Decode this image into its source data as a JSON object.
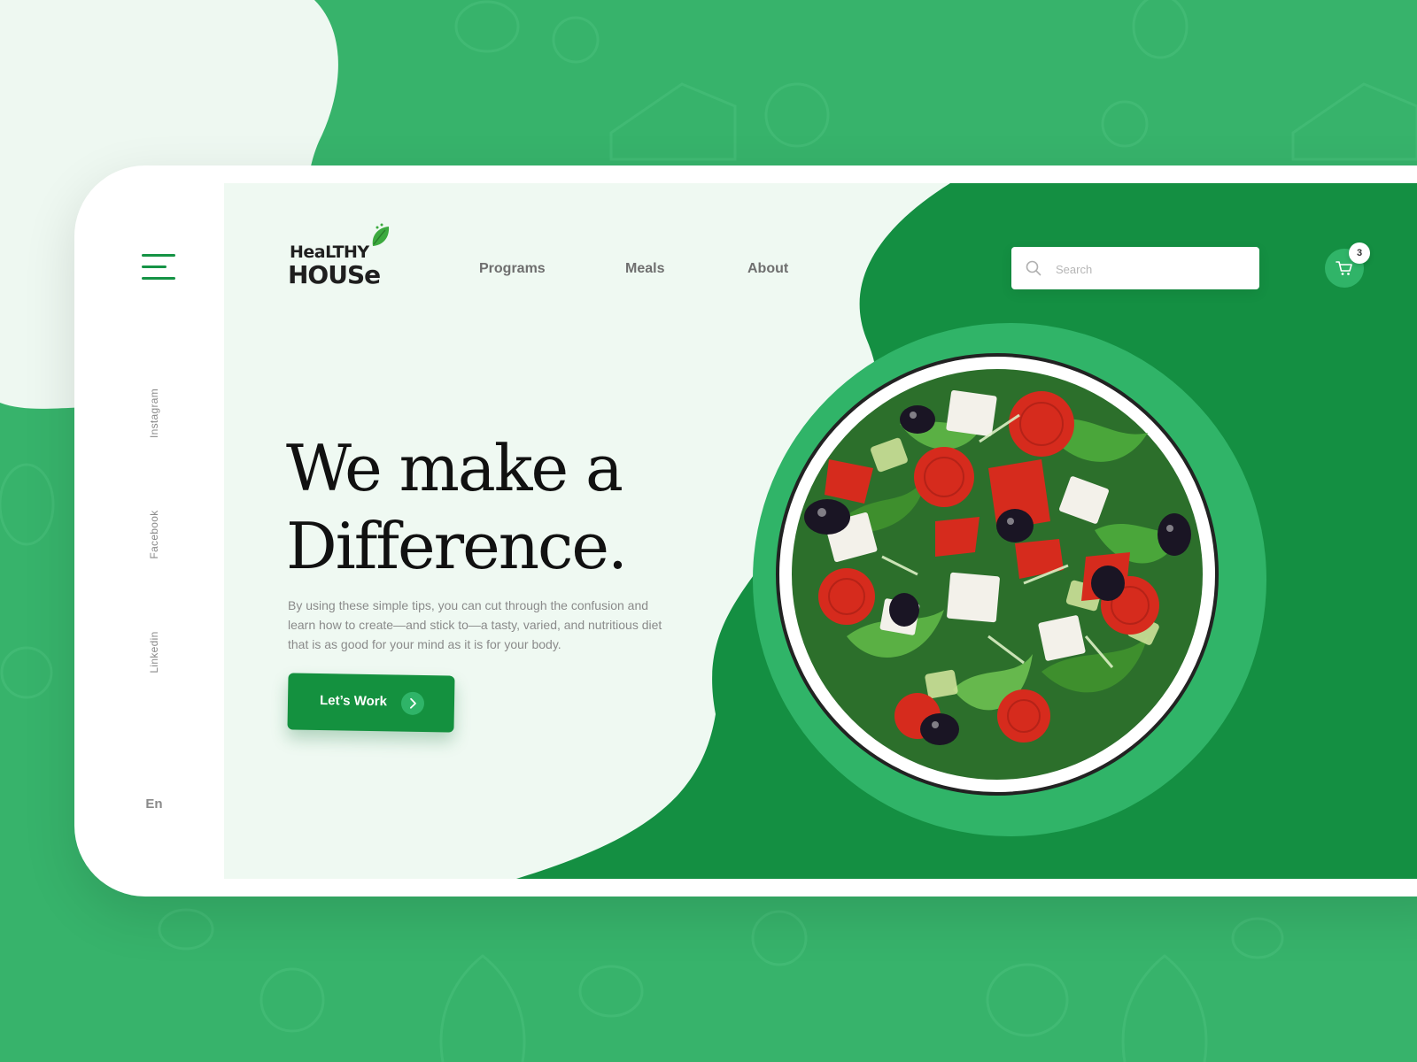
{
  "brand": {
    "line1": "HeaLTHY",
    "line2": "HOUSe"
  },
  "nav": [
    {
      "label": "Programs"
    },
    {
      "label": "Meals"
    },
    {
      "label": "About"
    }
  ],
  "search": {
    "placeholder": "Search"
  },
  "cart": {
    "count": "3"
  },
  "social": [
    "Instagram",
    "Facebook",
    "Linkedin"
  ],
  "language": "En",
  "hero": {
    "title_line1": "We make a",
    "title_line2": "Difference.",
    "text": "By using these simple tips, you can cut through the confusion and learn how to create—and stick to—a tasty, varied, and nutritious diet that is as good for your mind as it is for your body.",
    "cta_label": "Let’s Work"
  },
  "colors": {
    "background": "#37b36b",
    "primary": "#14913f",
    "panel": "#eff9f2",
    "accent": "#30b468"
  },
  "icons": [
    "menu-icon",
    "leaf-icon",
    "search-icon",
    "cart-icon",
    "chevron-right-icon"
  ]
}
